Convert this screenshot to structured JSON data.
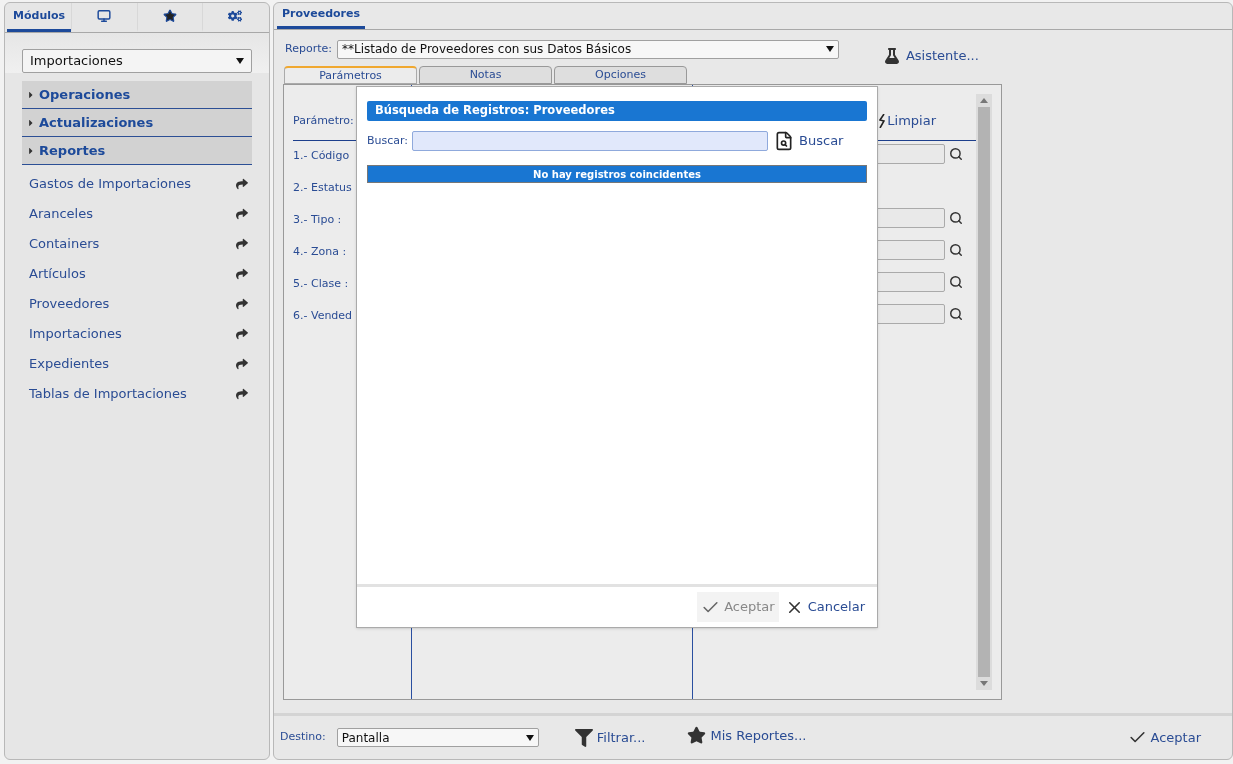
{
  "sidebar": {
    "tabs": [
      {
        "kind": "text",
        "label": "Módulos",
        "selected": true
      },
      {
        "kind": "monitor",
        "selected": false
      },
      {
        "kind": "star",
        "selected": false
      },
      {
        "kind": "gears",
        "selected": false
      }
    ],
    "module_select": "Importaciones",
    "groups": [
      {
        "label": "Operaciones",
        "expanded": false
      },
      {
        "label": "Actualizaciones",
        "expanded": false
      },
      {
        "label": "Reportes",
        "expanded": false
      }
    ],
    "items": [
      "Gastos de Importaciones",
      "Aranceles",
      "Containers",
      "Artículos",
      "Proveedores",
      "Importaciones",
      "Expedientes",
      "Tablas de Importaciones"
    ]
  },
  "main": {
    "tab": "Proveedores",
    "report_label": "Reporte:",
    "report": "**Listado de Proveedores con sus Datos Básicos",
    "assistant": "Asistente...",
    "tabs": [
      {
        "label": "Parámetros",
        "selected": true
      },
      {
        "label": "Notas",
        "selected": false
      },
      {
        "label": "Opciones",
        "selected": false
      }
    ],
    "param_header": "Parámetro:",
    "clear": "Limpiar",
    "params": [
      {
        "label": "1.- Código",
        "kind": "lookup"
      },
      {
        "label": "2.- Estatus",
        "kind": "plain"
      },
      {
        "label": "3.- Tipo :",
        "kind": "lookup"
      },
      {
        "label": "4.- Zona :",
        "kind": "lookup"
      },
      {
        "label": "5.- Clase :",
        "kind": "lookup"
      },
      {
        "label": "6.- Vended",
        "kind": "lookup"
      }
    ],
    "destination_label": "Destino:",
    "destination": "Pantalla",
    "filter": "Filtrar...",
    "my_reports": "Mis Reportes...",
    "accept": "Aceptar"
  },
  "dialog": {
    "title": "Búsqueda de Registros: Proveedores",
    "search_label": "Buscar:",
    "search_button": "Buscar",
    "empty_message": "No hay registros coincidentes",
    "accept": {
      "label": "Aceptar",
      "disabled": true
    },
    "cancel": "Cancelar"
  }
}
